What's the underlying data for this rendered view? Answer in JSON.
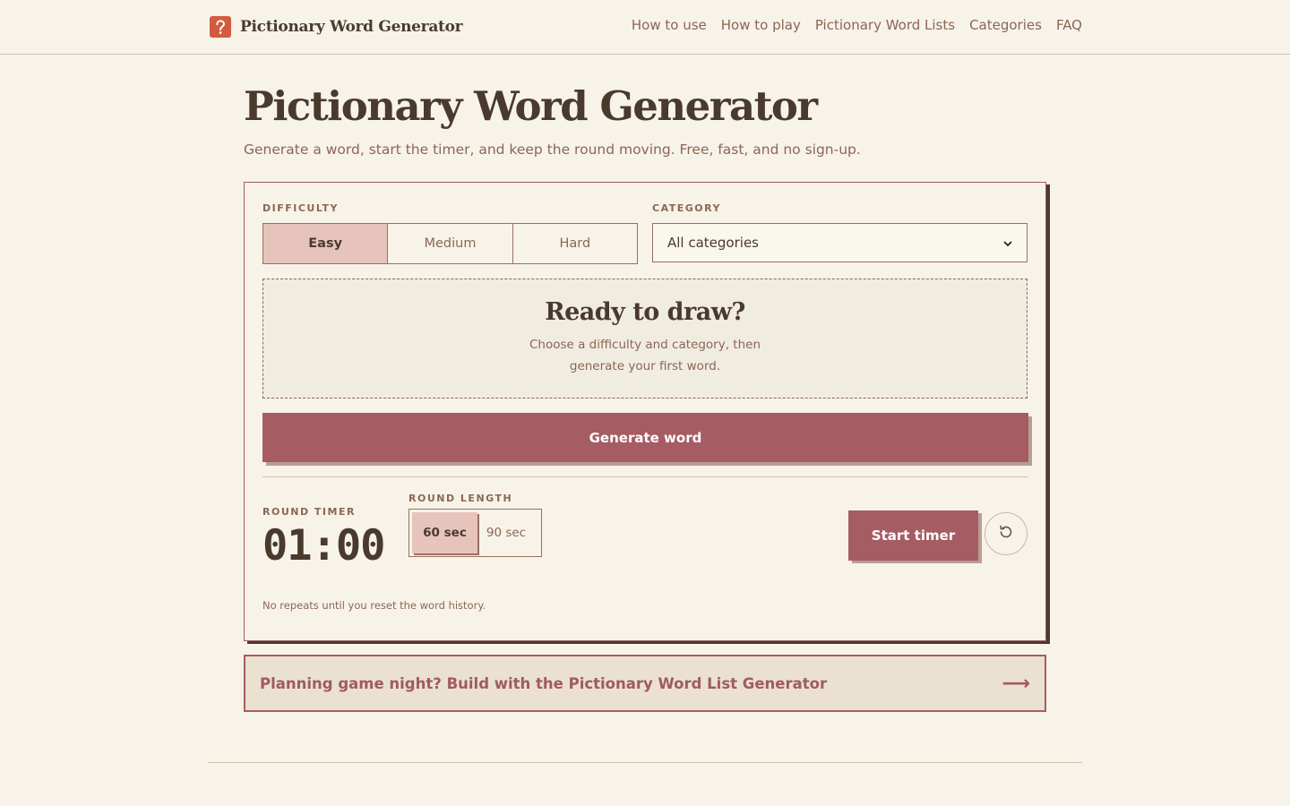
{
  "header": {
    "brand": "Pictionary Word Generator",
    "nav": [
      "How to use",
      "How to play",
      "Pictionary Word Lists",
      "Categories",
      "FAQ"
    ]
  },
  "hero": {
    "title": "Pictionary Word Generator",
    "subtitle": "Generate a word, start the timer, and keep the round moving. Free, fast, and no sign-up."
  },
  "generator": {
    "difficulty_label": "DIFFICULTY",
    "difficulty_options": [
      "Easy",
      "Medium",
      "Hard"
    ],
    "difficulty_selected": "Easy",
    "category_label": "CATEGORY",
    "category_value": "All categories",
    "ready_title": "Ready to draw?",
    "ready_text": "Choose a difficulty and category, then generate your first word.",
    "generate_label": "Generate word",
    "timer_label": "ROUND TIMER",
    "timer_value": "01:00",
    "round_length_label": "ROUND LENGTH",
    "round_length_options": [
      "60 sec",
      "90 sec"
    ],
    "round_length_selected": "60 sec",
    "start_label": "Start timer",
    "reset_icon": "reset-icon",
    "note": "No repeats until you reset the word history."
  },
  "promo": {
    "text": "Planning game night? Build with the Pictionary Word List Generator",
    "arrow": "⟶"
  },
  "colors": {
    "background": "#f7f3e9",
    "accent": "#a65c63",
    "selected": "#e7c4bb",
    "text": "#4a3a2e",
    "muted": "#8c6654"
  }
}
